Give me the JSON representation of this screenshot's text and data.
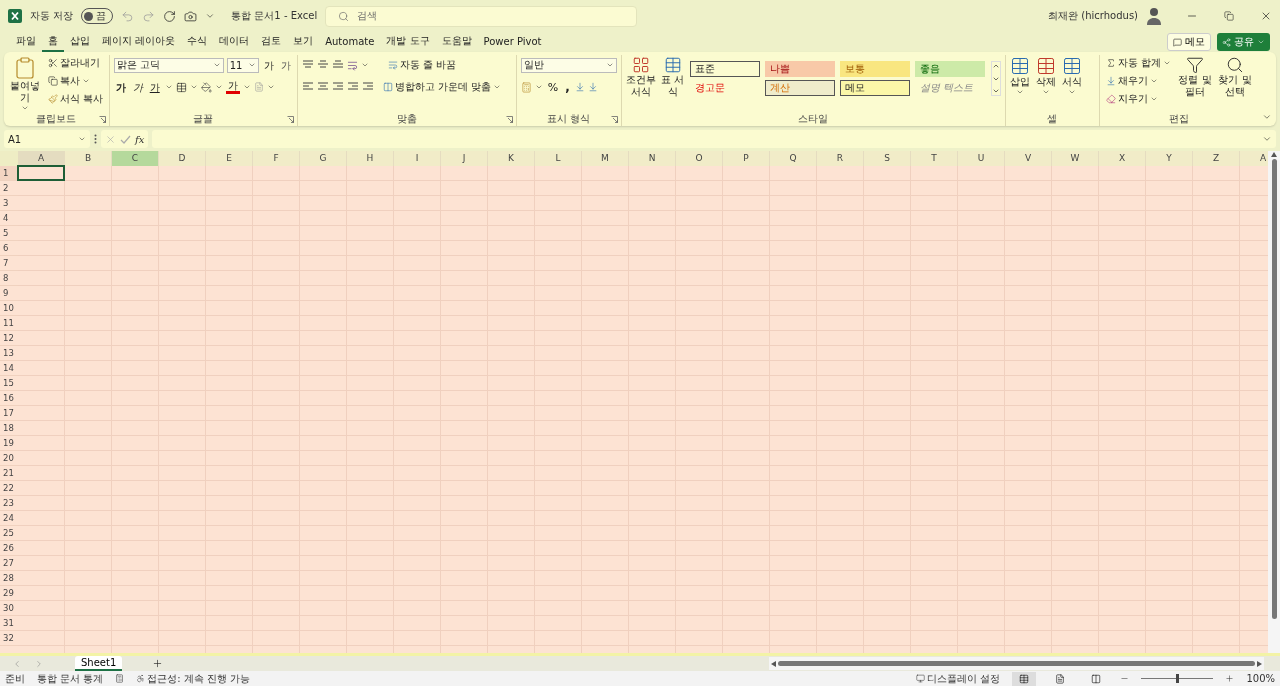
{
  "title_bar": {
    "autosave": {
      "label": "자동 저장",
      "on": false,
      "state_label": "끔"
    },
    "document_title": "통합 문서1  -  Excel",
    "search": {
      "placeholder": "검색"
    },
    "user": "최재완 (hicrhodus)"
  },
  "menu_tabs": [
    {
      "label": "파일",
      "selected": false
    },
    {
      "label": "홈",
      "selected": true
    },
    {
      "label": "삽입",
      "selected": false
    },
    {
      "label": "페이지 레이아웃",
      "selected": false
    },
    {
      "label": "수식",
      "selected": false
    },
    {
      "label": "데이터",
      "selected": false
    },
    {
      "label": "검토",
      "selected": false
    },
    {
      "label": "보기",
      "selected": false
    },
    {
      "label": "Automate",
      "selected": false
    },
    {
      "label": "개발 도구",
      "selected": false
    },
    {
      "label": "도움말",
      "selected": false
    },
    {
      "label": "Power Pivot",
      "selected": false
    }
  ],
  "header_buttons": {
    "comment": "메모",
    "share": "공유"
  },
  "ribbon": {
    "clipboard": {
      "label": "클립보드",
      "paste": "붙여넣기",
      "cut": "잘라내기",
      "copy": "복사",
      "format_painter": "서식 복사"
    },
    "font": {
      "label": "글꼴",
      "font_name": "맑은 고딕",
      "font_size": "11",
      "grow": "가",
      "shrink": "가",
      "bold": "가",
      "italic": "가",
      "underline": "가",
      "font_color": "가"
    },
    "alignment": {
      "label": "맞춤",
      "wrap_text": "자동 줄 바꿈",
      "merge": "병합하고 가운데 맞춤"
    },
    "number": {
      "label": "표시 형식",
      "format": "일반",
      "percent": "%",
      "comma": ","
    },
    "styles": {
      "label": "스타일",
      "conditional": "조건부 서식",
      "format_table": "표 서식",
      "cell_styles": [
        {
          "name": "표준",
          "kind": "normal",
          "color": "#fbfbd0"
        },
        {
          "name": "나쁨",
          "kind": "bad",
          "color": "#f8c9a8"
        },
        {
          "name": "보통",
          "kind": "neutral",
          "color": "#f9e680"
        },
        {
          "name": "좋음",
          "kind": "good",
          "color": "#cdeaa8"
        },
        {
          "name": "경고문",
          "kind": "warning",
          "color": "#fbfbd0"
        },
        {
          "name": "계산",
          "kind": "calculation",
          "color": "#efeccb"
        },
        {
          "name": "메모",
          "kind": "note",
          "color": "#fbf7a8"
        },
        {
          "name": "설명 텍스트",
          "kind": "explanatory",
          "color": "#fbfbd0"
        }
      ]
    },
    "cells": {
      "label": "셀",
      "insert": "삽입",
      "delete": "삭제",
      "format": "서식"
    },
    "editing": {
      "label": "편집",
      "autosum": "자동 합계",
      "fill": "채우기",
      "clear": "지우기",
      "sort_filter": "정렬 및 필터",
      "find_select": "찾기 및 선택"
    }
  },
  "formula_bar": {
    "name_box": "A1",
    "fx": "fx"
  },
  "sheet": {
    "columns": [
      {
        "label": "A",
        "selected": true,
        "highlighted": false
      },
      {
        "label": "B",
        "selected": false,
        "highlighted": false
      },
      {
        "label": "C",
        "selected": false,
        "highlighted": true
      },
      {
        "label": "D",
        "selected": false,
        "highlighted": false
      },
      {
        "label": "E",
        "selected": false,
        "highlighted": false
      },
      {
        "label": "F",
        "selected": false,
        "highlighted": false
      },
      {
        "label": "G",
        "selected": false,
        "highlighted": false
      },
      {
        "label": "H",
        "selected": false,
        "highlighted": false
      },
      {
        "label": "I",
        "selected": false,
        "highlighted": false
      },
      {
        "label": "J",
        "selected": false,
        "highlighted": false
      },
      {
        "label": "K",
        "selected": false,
        "highlighted": false
      },
      {
        "label": "L",
        "selected": false,
        "highlighted": false
      },
      {
        "label": "M",
        "selected": false,
        "highlighted": false
      },
      {
        "label": "N",
        "selected": false,
        "highlighted": false
      },
      {
        "label": "O",
        "selected": false,
        "highlighted": false
      },
      {
        "label": "P",
        "selected": false,
        "highlighted": false
      },
      {
        "label": "Q",
        "selected": false,
        "highlighted": false
      },
      {
        "label": "R",
        "selected": false,
        "highlighted": false
      },
      {
        "label": "S",
        "selected": false,
        "highlighted": false
      },
      {
        "label": "T",
        "selected": false,
        "highlighted": false
      },
      {
        "label": "U",
        "selected": false,
        "highlighted": false
      },
      {
        "label": "V",
        "selected": false,
        "highlighted": false
      },
      {
        "label": "W",
        "selected": false,
        "highlighted": false
      },
      {
        "label": "X",
        "selected": false,
        "highlighted": false
      },
      {
        "label": "Y",
        "selected": false,
        "highlighted": false
      },
      {
        "label": "Z",
        "selected": false,
        "highlighted": false
      },
      {
        "label": "A",
        "selected": false,
        "highlighted": false
      }
    ],
    "rows": [
      {
        "label": "1",
        "selected": true
      },
      {
        "label": "2",
        "selected": false
      },
      {
        "label": "3",
        "selected": false
      },
      {
        "label": "4",
        "selected": false
      },
      {
        "label": "5",
        "selected": false
      },
      {
        "label": "6",
        "selected": false
      },
      {
        "label": "7",
        "selected": false
      },
      {
        "label": "8",
        "selected": false
      },
      {
        "label": "9",
        "selected": false
      },
      {
        "label": "10",
        "selected": false
      },
      {
        "label": "11",
        "selected": false
      },
      {
        "label": "12",
        "selected": false
      },
      {
        "label": "13",
        "selected": false
      },
      {
        "label": "14",
        "selected": false
      },
      {
        "label": "15",
        "selected": false
      },
      {
        "label": "16",
        "selected": false
      },
      {
        "label": "17",
        "selected": false
      },
      {
        "label": "18",
        "selected": false
      },
      {
        "label": "19",
        "selected": false
      },
      {
        "label": "20",
        "selected": false
      },
      {
        "label": "21",
        "selected": false
      },
      {
        "label": "22",
        "selected": false
      },
      {
        "label": "23",
        "selected": false
      },
      {
        "label": "24",
        "selected": false
      },
      {
        "label": "25",
        "selected": false
      },
      {
        "label": "26",
        "selected": false
      },
      {
        "label": "27",
        "selected": false
      },
      {
        "label": "28",
        "selected": false
      },
      {
        "label": "29",
        "selected": false
      },
      {
        "label": "30",
        "selected": false
      },
      {
        "label": "31",
        "selected": false
      },
      {
        "label": "32",
        "selected": false
      }
    ]
  },
  "sheet_tabs": [
    {
      "label": "Sheet1",
      "selected": true
    }
  ],
  "status_bar": {
    "ready": "준비",
    "workbook_stats": "통합 문서 통계",
    "accessibility": "접근성: 계속 진행 가능",
    "display_settings": "디스플레이 설정",
    "zoom": {
      "level": 0.5,
      "reading": "100%"
    }
  }
}
